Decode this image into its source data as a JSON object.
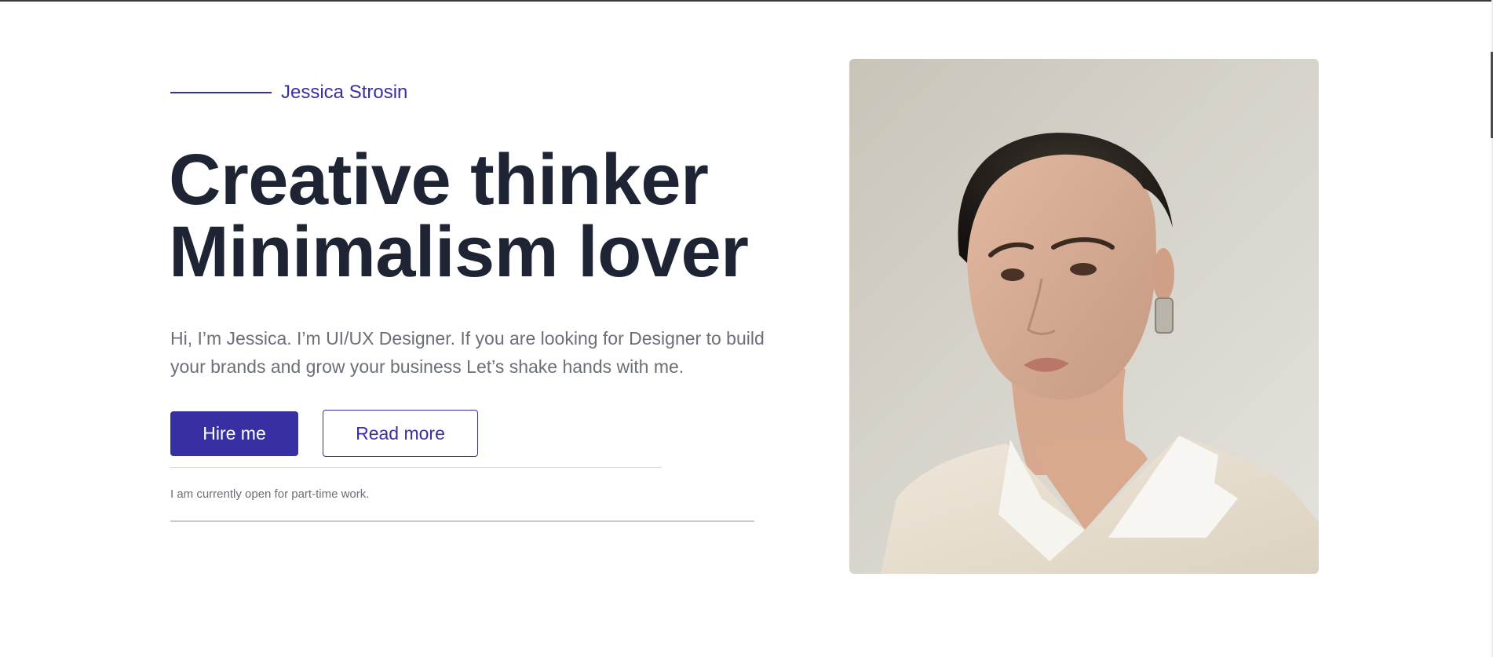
{
  "hero": {
    "name": "Jessica Strosin",
    "headline_line1": "Creative thinker",
    "headline_line2": "Minimalism lover",
    "intro": "Hi, I’m Jessica. I’m UI/UX Designer. If you are looking for Designer to build your brands and grow your business Let’s shake hands with me.",
    "hire_button": "Hire me",
    "read_more_button": "Read more",
    "availability": "I am currently open for part-time work."
  },
  "colors": {
    "accent": "#3730a3",
    "heading": "#1e2433",
    "body_text": "#6b6f79"
  },
  "portrait": {
    "icon": "portrait-photo"
  }
}
